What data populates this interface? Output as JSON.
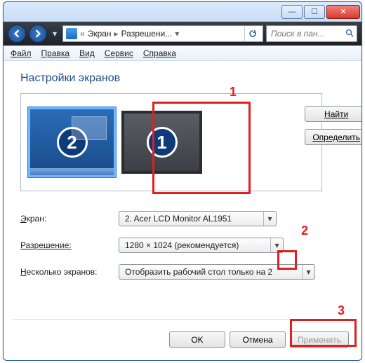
{
  "titlebar": {
    "minimize_glyph": "—",
    "maximize_glyph": "☐",
    "close_glyph": "✕"
  },
  "nav": {
    "crumb1": "Экран",
    "crumb2": "Разрешени...",
    "search_placeholder": "Поиск в пан..."
  },
  "menu": {
    "file": "Файл",
    "edit": "Правка",
    "view": "Вид",
    "service": "Сервис",
    "help": "Справка"
  },
  "page": {
    "title": "Настройки экранов"
  },
  "monitors": {
    "primary_num": "1",
    "secondary_num": "2",
    "find_btn": "Найти",
    "identify_btn": "Определить"
  },
  "form": {
    "screen_label": "Экран:",
    "screen_value": "2. Acer LCD Monitor AL1951",
    "resolution_label": "Разрешение:",
    "resolution_value": "1280 × 1024 (рекомендуется)",
    "multi_label": "Несколько экранов:",
    "multi_value": "Отобразить рабочий стол только на 2"
  },
  "buttons": {
    "ok": "OK",
    "cancel": "Отмена",
    "apply": "Применить"
  },
  "annotations": {
    "a1": "1",
    "a2": "2",
    "a3": "3"
  }
}
